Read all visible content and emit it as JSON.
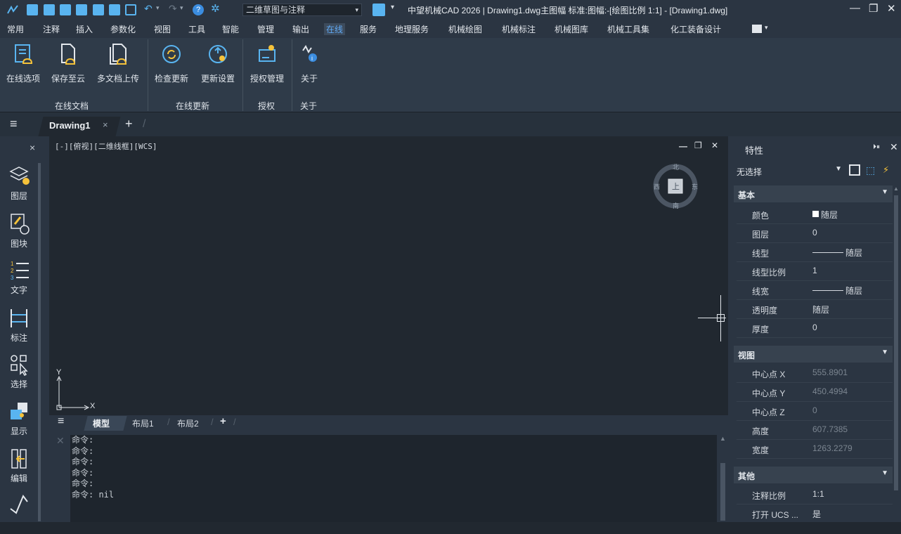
{
  "titlebar": {
    "workspace": "二维草图与注释",
    "title": "中望机械CAD 2026 | Drawing1.dwg主图幅 标准:图幅:-[绘图比例 1:1] - [Drawing1.dwg]",
    "minimize": "—",
    "restore": "❐",
    "close": "✕"
  },
  "menu": {
    "items": [
      "常用",
      "注释",
      "插入",
      "参数化",
      "视图",
      "工具",
      "智能",
      "管理",
      "输出",
      "在线",
      "服务",
      "地理服务",
      "机械绘图",
      "机械标注",
      "机械图库",
      "机械工具集",
      "化工装备设计"
    ],
    "active": "在线"
  },
  "ribbon": {
    "buttons": [
      {
        "label": "在线选项",
        "icon": "online-options-icon"
      },
      {
        "label": "保存至云",
        "icon": "cloud-save-icon"
      },
      {
        "label": "多文档上传",
        "icon": "multi-upload-icon"
      },
      {
        "label": "检查更新",
        "icon": "check-update-icon"
      },
      {
        "label": "更新设置",
        "icon": "update-settings-icon"
      },
      {
        "label": "授权管理",
        "icon": "license-icon"
      },
      {
        "label": "关于",
        "icon": "about-icon"
      }
    ],
    "groups": [
      "在线文档",
      "在线更新",
      "授权",
      "关于"
    ]
  },
  "tabs": {
    "document": "Drawing1",
    "close": "×",
    "add": "+"
  },
  "left_toolbar": {
    "close": "×",
    "items": [
      {
        "label": "图层",
        "icon": "layer-icon"
      },
      {
        "label": "图块",
        "icon": "block-icon"
      },
      {
        "label": "文字",
        "icon": "text-list-icon"
      },
      {
        "label": "标注",
        "icon": "dimension-icon"
      },
      {
        "label": "选择",
        "icon": "select-icon"
      },
      {
        "label": "显示",
        "icon": "display-icon"
      },
      {
        "label": "编辑",
        "icon": "edit-icon"
      }
    ]
  },
  "viewport": {
    "label": "[-][俯视][二维线框][WCS]",
    "controls": {
      "minimize": "—",
      "restore": "❐",
      "close": "✕"
    },
    "viewcube": {
      "north": "北",
      "south": "南",
      "east": "东",
      "west": "西",
      "top": "上"
    },
    "axis": {
      "x": "X",
      "y": "Y"
    }
  },
  "layout_tabs": {
    "items": [
      "模型",
      "布局1",
      "布局2"
    ],
    "active": "模型",
    "add": "+"
  },
  "command": {
    "lines": [
      "命令:",
      "命令:",
      "命令:",
      "命令:",
      "命令:",
      "命令: nil"
    ]
  },
  "properties": {
    "title": "特性",
    "selection": "无选择",
    "sections": {
      "basic": {
        "label": "基本",
        "rows": [
          {
            "key": "颜色",
            "value": "随层"
          },
          {
            "key": "图层",
            "value": "0"
          },
          {
            "key": "线型",
            "value": "随层"
          },
          {
            "key": "线型比例",
            "value": "1"
          },
          {
            "key": "线宽",
            "value": "随层"
          },
          {
            "key": "透明度",
            "value": "随层"
          },
          {
            "key": "厚度",
            "value": "0"
          }
        ]
      },
      "view": {
        "label": "视图",
        "rows": [
          {
            "key": "中心点 X",
            "value": "555.8901"
          },
          {
            "key": "中心点 Y",
            "value": "450.4994"
          },
          {
            "key": "中心点 Z",
            "value": "0"
          },
          {
            "key": "高度",
            "value": "607.7385"
          },
          {
            "key": "宽度",
            "value": "1263.2279"
          }
        ]
      },
      "other": {
        "label": "其他",
        "rows": [
          {
            "key": "注释比例",
            "value": "1:1"
          },
          {
            "key": "打开 UCS ...",
            "value": "是"
          }
        ]
      }
    }
  },
  "colors": {
    "accent": "#5fa9f5",
    "icon_blue": "#59b4f0",
    "icon_yellow": "#f5c23a",
    "background": "#212830",
    "panel": "#2b3542"
  }
}
